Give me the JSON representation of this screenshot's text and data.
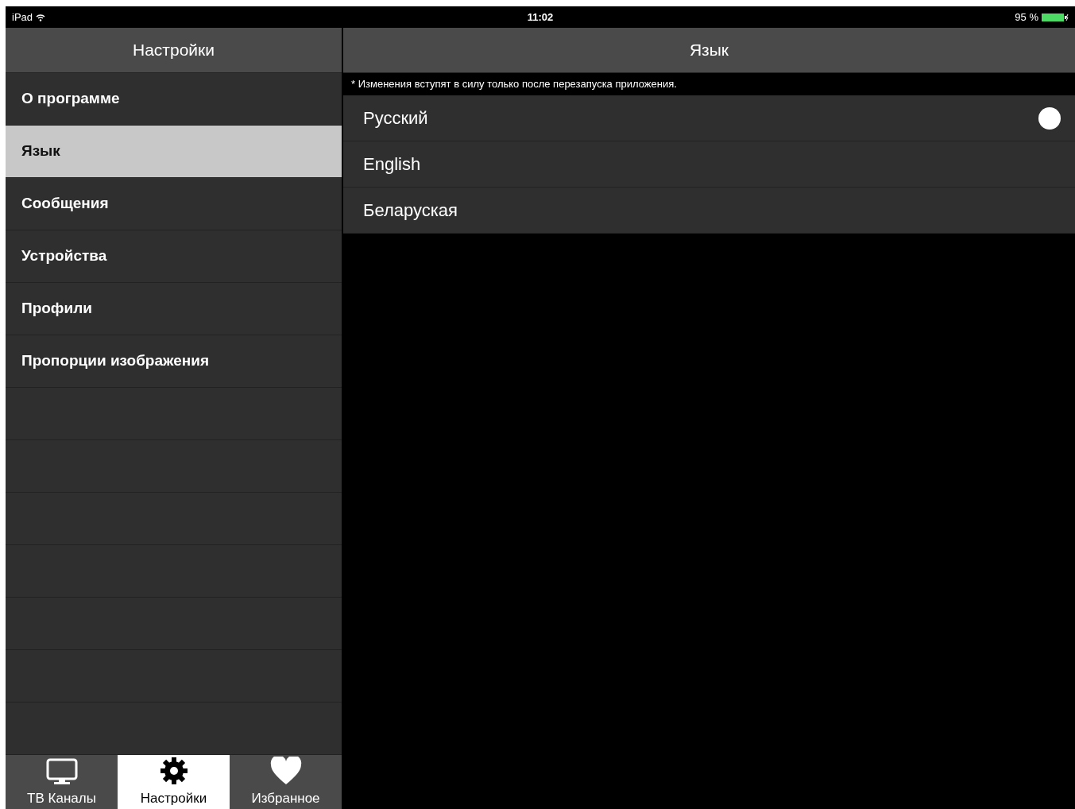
{
  "status_bar": {
    "device": "iPad",
    "time": "11:02",
    "battery": "95 %"
  },
  "sidebar": {
    "title": "Настройки",
    "items": [
      {
        "label": "О программе",
        "selected": false
      },
      {
        "label": "Язык",
        "selected": true
      },
      {
        "label": "Сообщения",
        "selected": false
      },
      {
        "label": "Устройства",
        "selected": false
      },
      {
        "label": "Профили",
        "selected": false
      },
      {
        "label": "Пропорции изображения",
        "selected": false
      }
    ]
  },
  "tab_bar": [
    {
      "kind": "tv",
      "label": "ТВ Каналы",
      "selected": false
    },
    {
      "kind": "settings",
      "label": "Настройки",
      "selected": true
    },
    {
      "kind": "favorites",
      "label": "Избранное",
      "selected": false
    }
  ],
  "detail": {
    "title": "Язык",
    "note": "* Изменения вступят в силу только после перезапуска приложения.",
    "options": [
      {
        "label": "Русский",
        "selected": true
      },
      {
        "label": "English",
        "selected": false
      },
      {
        "label": "Беларуская",
        "selected": false
      }
    ]
  }
}
